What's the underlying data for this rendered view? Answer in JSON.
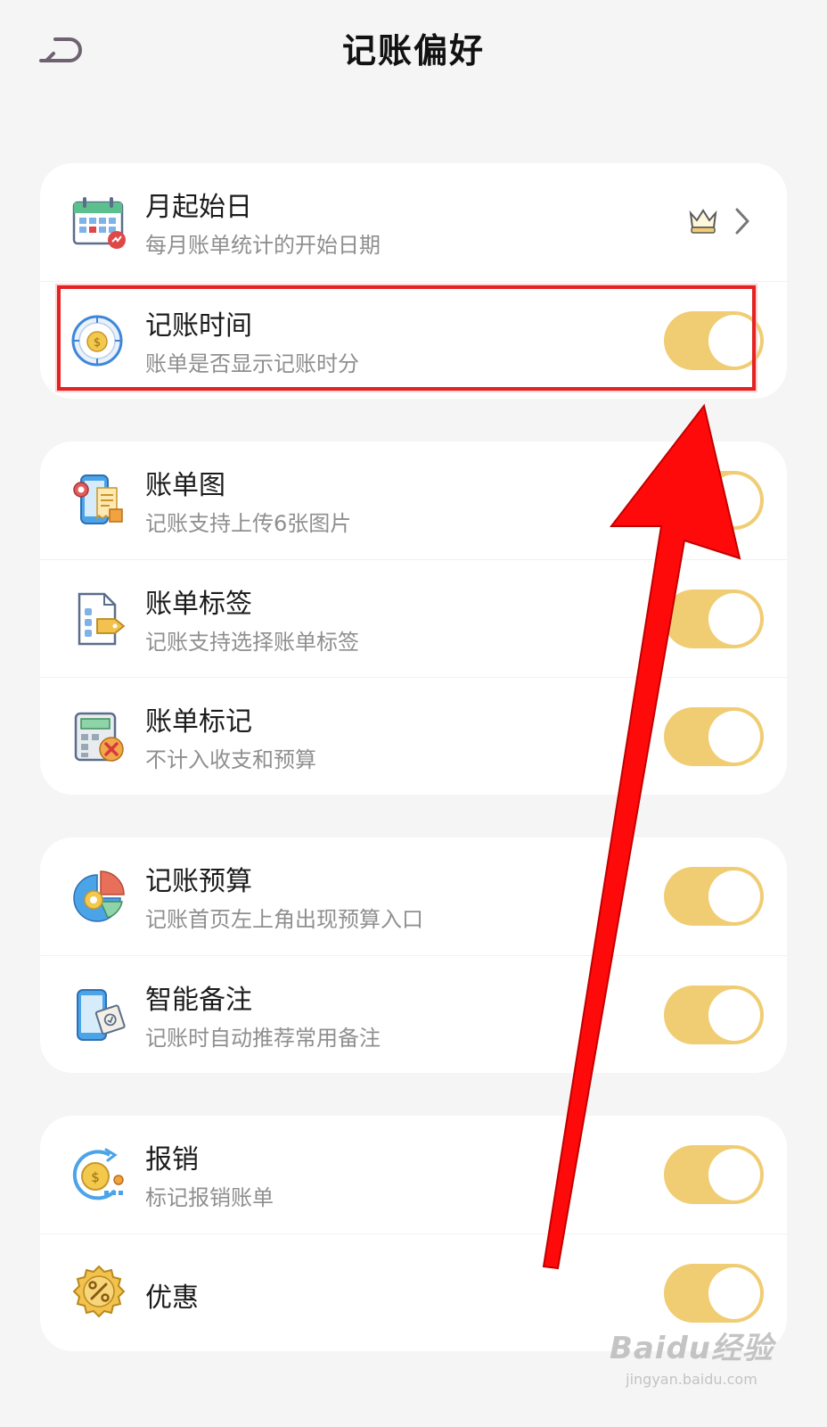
{
  "header": {
    "title": "记账偏好"
  },
  "groups": [
    {
      "rows": [
        {
          "title": "月起始日",
          "subtitle": "每月账单统计的开始日期"
        },
        {
          "title": "记账时间",
          "subtitle": "账单是否显示记账时分",
          "toggle_on": true
        }
      ]
    },
    {
      "rows": [
        {
          "title": "账单图",
          "subtitle": "记账支持上传6张图片",
          "toggle_on": true
        },
        {
          "title": "账单标签",
          "subtitle": "记账支持选择账单标签",
          "toggle_on": true
        },
        {
          "title": "账单标记",
          "subtitle": "不计入收支和预算",
          "toggle_on": true
        }
      ]
    },
    {
      "rows": [
        {
          "title": "记账预算",
          "subtitle": "记账首页左上角出现预算入口",
          "toggle_on": true
        },
        {
          "title": "智能备注",
          "subtitle": "记账时自动推荐常用备注",
          "toggle_on": true
        }
      ]
    },
    {
      "rows": [
        {
          "title": "报销",
          "subtitle": "标记报销账单",
          "toggle_on": true
        },
        {
          "title": "优惠",
          "toggle_on": true
        }
      ]
    }
  ],
  "icons": {
    "back": "back-arrow-icon",
    "month_start": "calendar-icon",
    "time": "clock-coin-icon",
    "bill_image": "phone-receipt-icon",
    "bill_tag": "document-tag-icon",
    "bill_mark": "calculator-cross-icon",
    "budget": "pie-chart-icon",
    "smart_note": "phone-note-icon",
    "reimburse": "coin-cycle-icon",
    "discount": "discount-badge-icon",
    "vip": "crown-icon",
    "chevron": "chevron-right-icon"
  },
  "colors": {
    "toggle_on": "#f0cd73",
    "highlight": "#e32222",
    "arrow": "#ff0a0a",
    "background": "#f5f5f5"
  },
  "watermark": {
    "main": "Baidu经验",
    "sub": "jingyan.baidu.com"
  }
}
